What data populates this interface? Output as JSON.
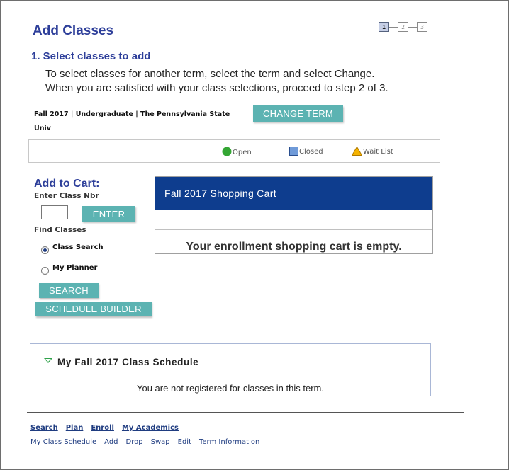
{
  "header": {
    "title": "Add Classes",
    "steps": [
      "1",
      "2",
      "3"
    ]
  },
  "section": {
    "heading": "1.  Select classes to add",
    "instruction_line1": "To select classes for another term, select the term and select Change.",
    "instruction_line2": "When you are satisfied with your class selections, proceed to step 2 of 3."
  },
  "term": {
    "line1": "Fall 2017 | Undergraduate | The Pennsylvania State",
    "line2": "Univ",
    "change_button": "CHANGE TERM"
  },
  "legend": {
    "open": "Open",
    "closed": "Closed",
    "wait_list": "Wait List",
    "colors": {
      "open": "#34a634",
      "closed": "#6f9ad8",
      "wait_list": "#f5b300"
    }
  },
  "add_to_cart": {
    "title": "Add to Cart:",
    "enter_label": "Enter Class Nbr",
    "class_nbr_value": "",
    "enter_button": "ENTER",
    "find_label": "Find Classes",
    "option_class_search": "Class Search",
    "option_my_planner": "My Planner",
    "selected_option": "Class Search",
    "search_button": "SEARCH",
    "schedule_builder_button": "SCHEDULE BUILDER"
  },
  "cart": {
    "title": "Fall 2017 Shopping Cart",
    "empty_message": "Your enrollment shopping cart is empty."
  },
  "schedule": {
    "title": "My Fall 2017 Class Schedule",
    "empty_message": "You are not registered for classes in this term."
  },
  "footer": {
    "primary_links": [
      "Search",
      "Plan",
      "Enroll",
      "My Academics"
    ],
    "secondary_links": [
      "My Class Schedule",
      "Add",
      "Drop",
      "Swap",
      "Edit",
      "Term Information"
    ]
  }
}
